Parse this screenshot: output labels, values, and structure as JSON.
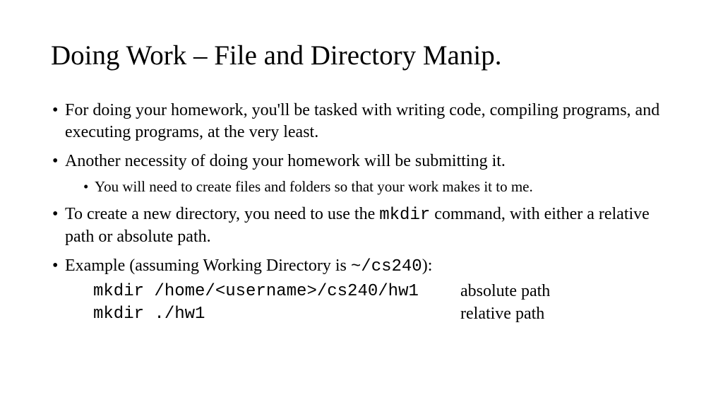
{
  "title": "Doing Work – File and Directory Manip.",
  "bullets": {
    "b1": "For doing your homework, you'll be tasked with writing code, compiling programs, and executing programs, at the very least.",
    "b2": "Another necessity of doing your homework will be submitting it.",
    "b2_sub": "You will need to create files and folders so that your work makes it to me.",
    "b3_a": "To create a new directory, you need to use the ",
    "b3_cmd": "mkdir",
    "b3_b": " command, with either a relative path or absolute path.",
    "b4_a": "Example (assuming Working Directory is ",
    "b4_path": "~/cs240",
    "b4_b": "):"
  },
  "examples": {
    "row1_cmd": "mkdir /home/<username>/cs240/hw1",
    "row1_label": "absolute path",
    "row2_cmd": "mkdir ./hw1",
    "row2_label": "relative path"
  }
}
